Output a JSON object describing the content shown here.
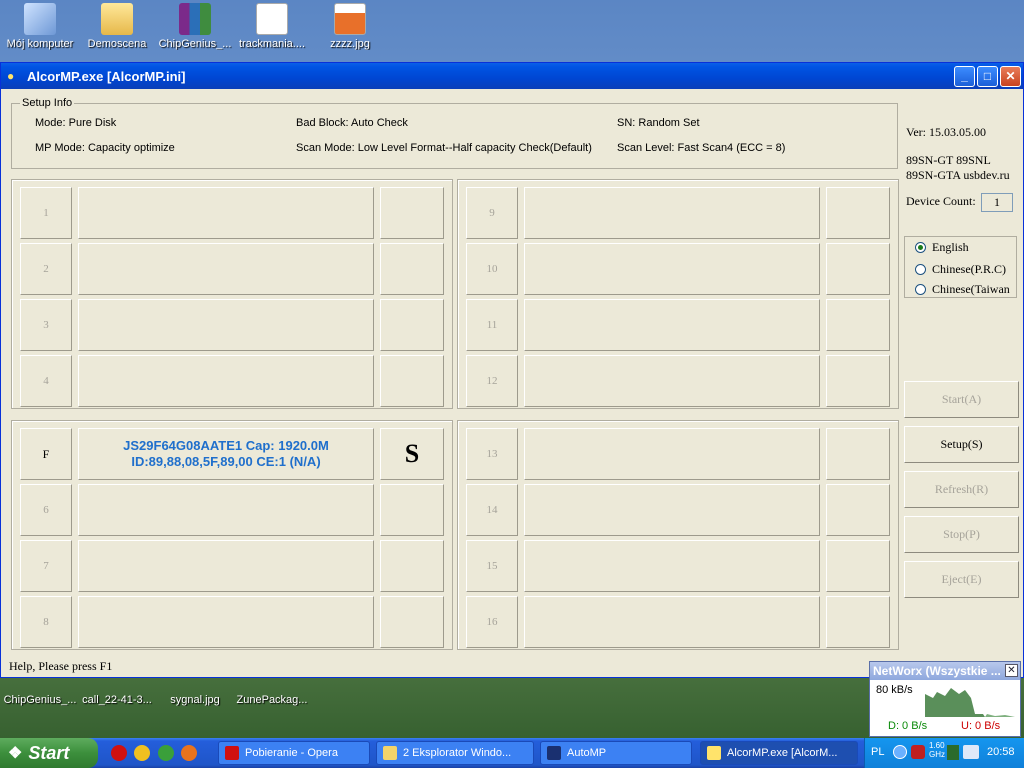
{
  "desktop": {
    "top_icons": [
      "Mój komputer",
      "Demoscena",
      "ChipGenius_...",
      "trackmania....",
      "zzzz.jpg"
    ],
    "bottom_icons": [
      "ChipGenius_...",
      "call_22-41-3...",
      "sygnal.jpg",
      "ZunePackag..."
    ]
  },
  "window": {
    "title": "AlcorMP.exe [AlcorMP.ini]",
    "setup": {
      "legend": "Setup Info",
      "mode": "Mode: Pure Disk",
      "mp_mode": "MP Mode: Capacity optimize",
      "bad_block": "Bad Block: Auto Check",
      "scan_mode": "Scan Mode: Low Level Format--Half capacity Check(Default)",
      "sn": "SN: Random Set",
      "scan_level": "Scan Level: Fast Scan4 (ECC = 8)"
    },
    "slots_left_top": [
      "1",
      "2",
      "3",
      "4"
    ],
    "slots_right_top": [
      "9",
      "10",
      "11",
      "12"
    ],
    "slots_left_bottom": [
      "F",
      "6",
      "7",
      "8"
    ],
    "slots_right_bottom": [
      "13",
      "14",
      "15",
      "16"
    ],
    "active_slot": {
      "line1": "JS29F64G08AATE1 Cap: 1920.0M",
      "line2": "ID:89,88,08,5F,89,00 CE:1 (N/A)",
      "status": "S"
    },
    "side": {
      "version": "Ver: 15.03.05.00",
      "chip1": "89SN-GT 89SNL",
      "chip2": "89SN-GTA usbdev.ru",
      "device_count_label": "Device Count:",
      "device_count": "1",
      "languages": [
        "English",
        "Chinese(P.R.C)",
        "Chinese(Taiwan"
      ],
      "selected_language": "English"
    },
    "buttons": {
      "start": "Start(A)",
      "setup": "Setup(S)",
      "refresh": "Refresh(R)",
      "stop": "Stop(P)",
      "eject": "Eject(E)"
    },
    "status": "Help, Please press F1"
  },
  "networx": {
    "title": "NetWorx (Wszystkie ...",
    "rate": "80 kB/s",
    "down": "D: 0 B/s",
    "up": "U: 0 B/s"
  },
  "taskbar": {
    "start": "Start",
    "tasks": [
      "Pobieranie - Opera",
      "2 Eksplorator Windo...",
      "AutoMP",
      "AlcorMP.exe [AlcorM..."
    ],
    "lang": "PL",
    "cpu": "1.60 GHz",
    "clock": "20:58"
  }
}
